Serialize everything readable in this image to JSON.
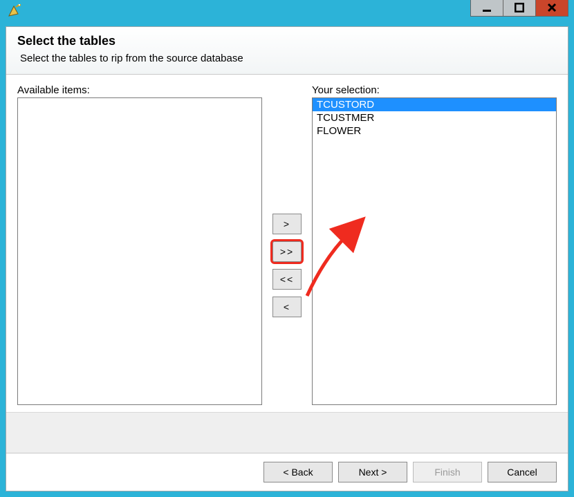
{
  "window": {
    "min_tooltip": "Minimize",
    "max_tooltip": "Maximize",
    "close_tooltip": "Close"
  },
  "header": {
    "title": "Select the tables",
    "subtitle": "Select the tables to rip from the source database"
  },
  "lists": {
    "available_label": "Available items:",
    "selection_label": "Your selection:",
    "available": [],
    "selected": [
      {
        "label": "TCUSTORD",
        "selected": true
      },
      {
        "label": "TCUSTMER",
        "selected": false
      },
      {
        "label": "FLOWER",
        "selected": false
      }
    ]
  },
  "move": {
    "add": ">",
    "add_all": ">>",
    "rem_all": "<<",
    "rem": "<"
  },
  "nav": {
    "back": "< Back",
    "next": "Next >",
    "finish": "Finish",
    "cancel": "Cancel"
  }
}
